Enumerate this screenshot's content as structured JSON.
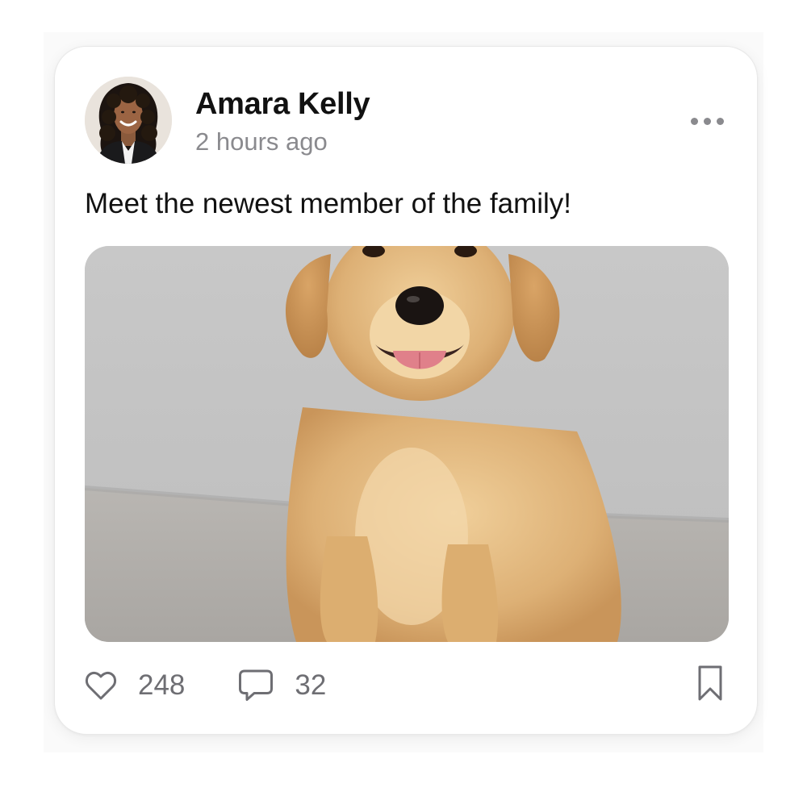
{
  "post": {
    "author_name": "Amara Kelly",
    "timestamp": "2 hours ago",
    "caption": "Meet the newest member of the family!",
    "avatar_icon": "avatar-photo",
    "photo_subject": "puppy-photo"
  },
  "actions": {
    "like_count": "248",
    "comment_count": "32",
    "like_icon": "heart-icon",
    "comment_icon": "comment-icon",
    "bookmark_icon": "bookmark-icon",
    "more_icon": "more-dots-icon"
  },
  "colors": {
    "primary_text": "#111111",
    "secondary_text": "#8a8a8e",
    "icon_gray": "#6e6e73",
    "card_background": "#ffffff"
  }
}
